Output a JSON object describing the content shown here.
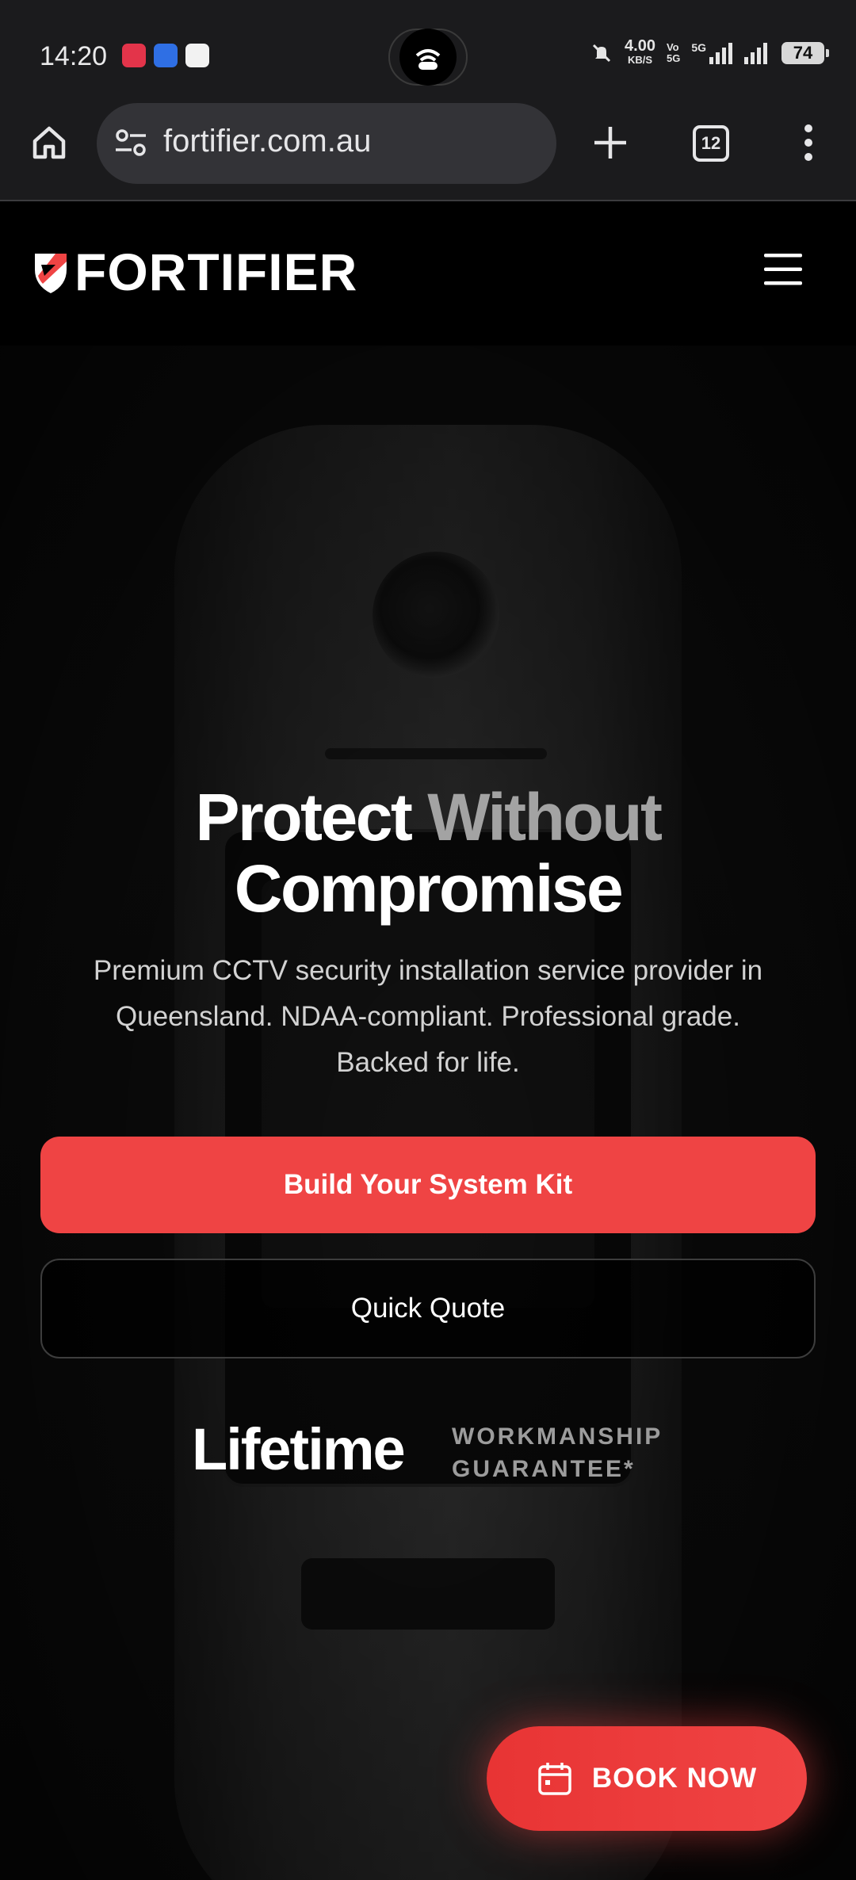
{
  "status_bar": {
    "time": "14:20",
    "speed_value": "4.00",
    "speed_unit": "KB/S",
    "network": "5G",
    "battery": "74"
  },
  "browser": {
    "url": "fortifier.com.au",
    "tab_count": "12"
  },
  "site": {
    "logo_text": "FORTIFIER"
  },
  "hero": {
    "headline_part1": "Protect",
    "headline_part2": "Without",
    "headline_part3": "Compromise",
    "subtitle_line1": "Premium CCTV security installation service provider in",
    "subtitle_line2": "Queensland. NDAA-compliant. Professional grade.",
    "subtitle_line3": "Backed for life.",
    "primary_button": "Build Your System Kit",
    "secondary_button": "Quick Quote",
    "guarantee_big": "Lifetime",
    "guarantee_small_line1": "WORKMANSHIP",
    "guarantee_small_line2": "GUARANTEE*"
  },
  "floating": {
    "book_now": "BOOK NOW"
  },
  "colors": {
    "accent": "#ef4444",
    "background": "#000000",
    "browser_chrome": "#1b1b1d"
  }
}
